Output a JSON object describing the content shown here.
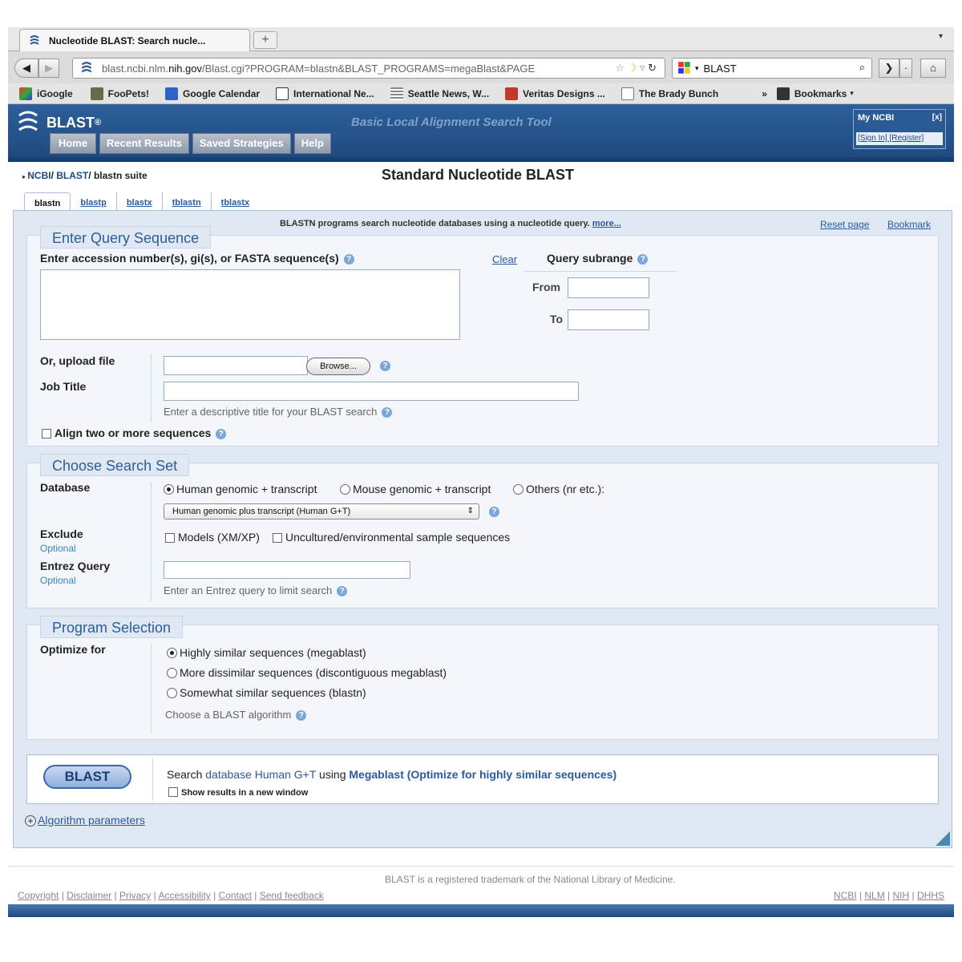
{
  "browser": {
    "tab_title": "Nucleotide BLAST: Search nucle...",
    "new_tab": "+",
    "url_host_pre": "blast.ncbi.nlm.",
    "url_host": "nih.gov",
    "url_path": "/Blast.cgi?PROGRAM=blastn&BLAST_PROGRAMS=megaBlast&PAGE",
    "search_value": "BLAST",
    "bookmarks": [
      "iGoogle",
      "FooPets!",
      "Google Calendar",
      "International Ne...",
      "Seattle News, W...",
      "Veritas Designs ...",
      "The Brady Bunch"
    ],
    "bookmarks_overflow": "»",
    "bookmarks_menu": "Bookmarks"
  },
  "header": {
    "logo": "BLAST",
    "logo_reg": "®",
    "tagline": "Basic Local Alignment Search Tool",
    "menu": [
      "Home",
      "Recent Results",
      "Saved Strategies",
      "Help"
    ],
    "myncbi_title": "My NCBI",
    "myncbi_close": "[x]",
    "myncbi_links": "[Sign In] [Register]"
  },
  "breadcrumb": {
    "ncbi": "NCBI",
    "blast": "BLAST",
    "suite": "blastn suite"
  },
  "page_title": "Standard Nucleotide BLAST",
  "program_tabs": [
    "blastn",
    "blastp",
    "blastx",
    "tblastn",
    "tblastx"
  ],
  "top_info": {
    "desc": "BLASTN programs search nucleotide databases using a nucleotide query.",
    "more": "more...",
    "reset": "Reset page",
    "bookmark": "Bookmark"
  },
  "query": {
    "legend": "Enter Query Sequence",
    "label": "Enter accession number(s), gi(s), or FASTA sequence(s)",
    "clear": "Clear",
    "subrange": "Query subrange",
    "from": "From",
    "to": "To",
    "upload": "Or, upload file",
    "browse": "Browse...",
    "job_title": "Job Title",
    "job_hint": "Enter a descriptive title for your BLAST search",
    "align_two": "Align two or more sequences"
  },
  "search_set": {
    "legend": "Choose Search Set",
    "database": "Database",
    "radios": [
      "Human genomic + transcript",
      "Mouse genomic + transcript",
      "Others (nr etc.):"
    ],
    "selected_db": "Human genomic plus transcript (Human G+T)",
    "exclude": "Exclude",
    "optional": "Optional",
    "exclude_opts": [
      "Models (XM/XP)",
      "Uncultured/environmental sample sequences"
    ],
    "entrez": "Entrez Query",
    "entrez_hint": "Enter an Entrez query to limit search"
  },
  "program": {
    "legend": "Program Selection",
    "optimize": "Optimize for",
    "options": [
      "Highly similar sequences (megablast)",
      "More dissimilar sequences (discontiguous megablast)",
      "Somewhat similar sequences (blastn)"
    ],
    "hint": "Choose a BLAST algorithm"
  },
  "submit": {
    "button": "BLAST",
    "pre": "Search ",
    "db": "database Human G+T",
    "using": " using ",
    "algo": "Megablast (Optimize for highly similar sequences)",
    "new_window": "Show results in a new window",
    "algo_params": "Algorithm parameters"
  },
  "footer": {
    "trademark": "BLAST is a registered trademark of the National Library of Medicine.",
    "links_left": [
      "Copyright",
      "Disclaimer",
      "Privacy",
      "Accessibility",
      "Contact",
      "Send feedback"
    ],
    "links_right": [
      "NCBI",
      "NLM",
      "NIH",
      "DHHS"
    ]
  },
  "colors": {
    "header_blue": "#1f4a80",
    "legend_blue": "#2d5d99",
    "link_blue": "#2a5aa0",
    "panel_bg": "#f3f6fa"
  }
}
